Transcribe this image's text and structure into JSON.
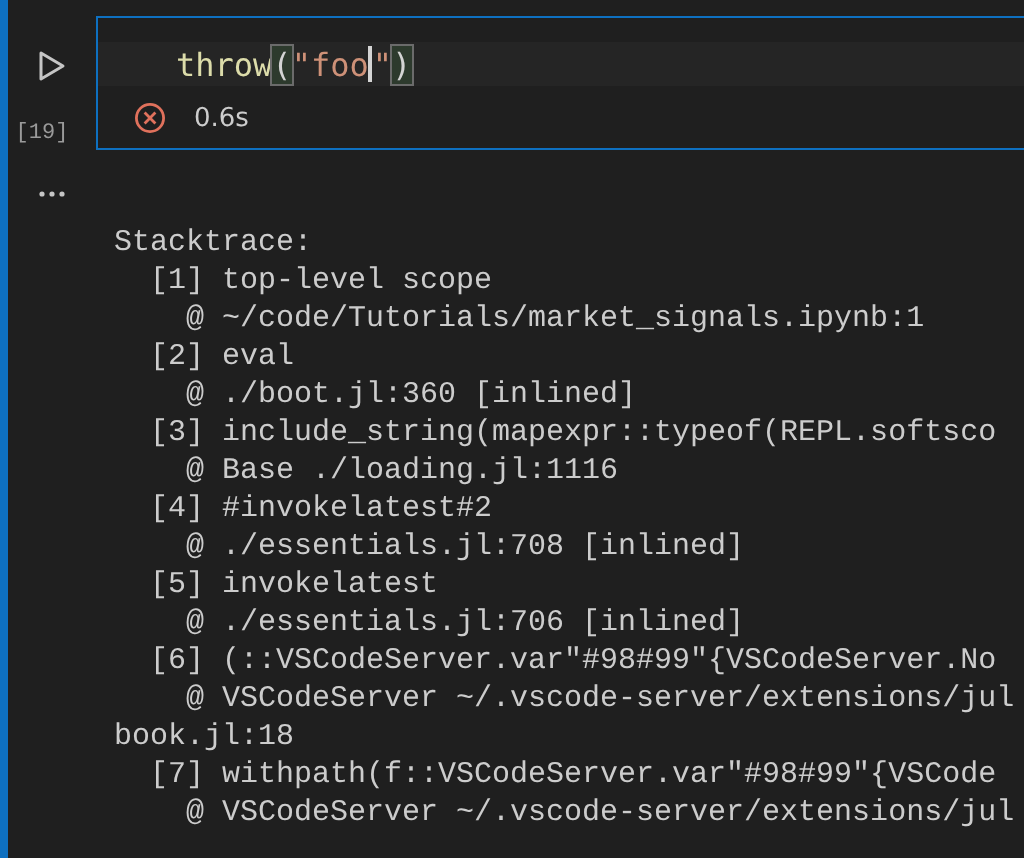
{
  "cell": {
    "execution_count": "[19]",
    "failed": true,
    "duration": "0.6s",
    "code": [
      {
        "text": "throw",
        "kind": "function",
        "cursor_after": false
      },
      {
        "text": "(",
        "kind": "bracket",
        "cursor_after": false
      },
      {
        "text": "\"foo",
        "kind": "string",
        "cursor_after": true
      },
      {
        "text": "\"",
        "kind": "string",
        "cursor_after": false
      },
      {
        "text": ")",
        "kind": "bracket",
        "cursor_after": false
      }
    ]
  },
  "output": {
    "lines": [
      "Stacktrace:",
      "  [1] top-level scope",
      "    @ ~/code/Tutorials/market_signals.ipynb:1",
      "  [2] eval",
      "    @ ./boot.jl:360 [inlined]",
      "  [3] include_string(mapexpr::typeof(REPL.softsco",
      "    @ Base ./loading.jl:1116",
      "  [4] #invokelatest#2",
      "    @ ./essentials.jl:708 [inlined]",
      "  [5] invokelatest",
      "    @ ./essentials.jl:706 [inlined]",
      "  [6] (::VSCodeServer.var\"#98#99\"{VSCodeServer.No",
      "    @ VSCodeServer ~/.vscode-server/extensions/jul",
      "book.jl:18",
      "  [7] withpath(f::VSCodeServer.var\"#98#99\"{VSCode",
      "    @ VSCodeServer ~/.vscode-server/extensions/jul"
    ]
  }
}
